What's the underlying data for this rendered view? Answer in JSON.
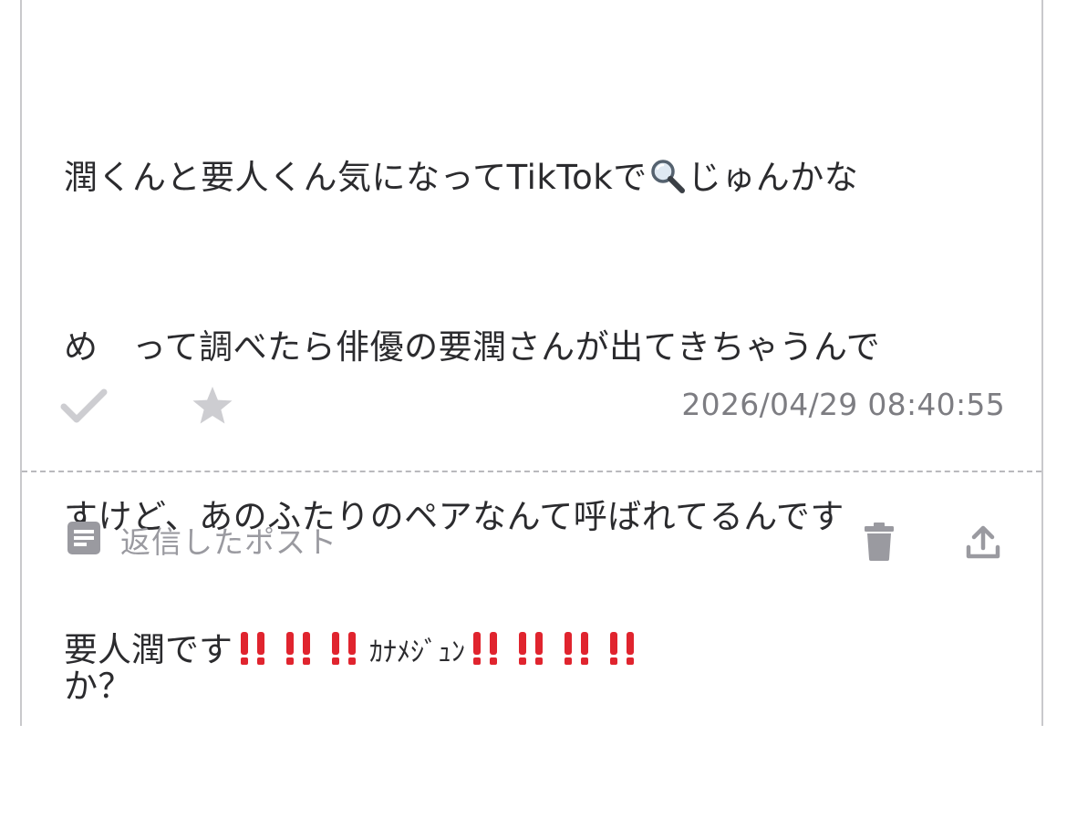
{
  "question": {
    "lines": [
      {
        "before": "潤くんと要人くん気になってTikTokで",
        "after": "じゅんかな"
      },
      {
        "text": "め　って調べたら俳優の要潤さんが出てきちゃうんで"
      },
      {
        "text": "すけど、あのふたりのペアなんて呼ばれてるんです"
      },
      {
        "text": "か？"
      }
    ],
    "inline_icon": "magnifying-glass-icon"
  },
  "actions": {
    "check_icon": "check-icon",
    "star_icon": "star-icon",
    "timestamp": "2026/04/29 08:40:55"
  },
  "reply": {
    "header_icon": "document-icon",
    "header_label": "返信したポスト",
    "delete_icon": "trash-icon",
    "share_icon": "share-icon",
    "text_main": "要人潤です",
    "text_kana": "ｶﾅﾒｼﾞｭﾝ",
    "bang_color": "#e0242e"
  },
  "colors": {
    "text": "#2b2b2e",
    "muted": "#9a9aa0",
    "icon_gray": "#c8c8cc",
    "timestamp": "#7d7d82"
  }
}
